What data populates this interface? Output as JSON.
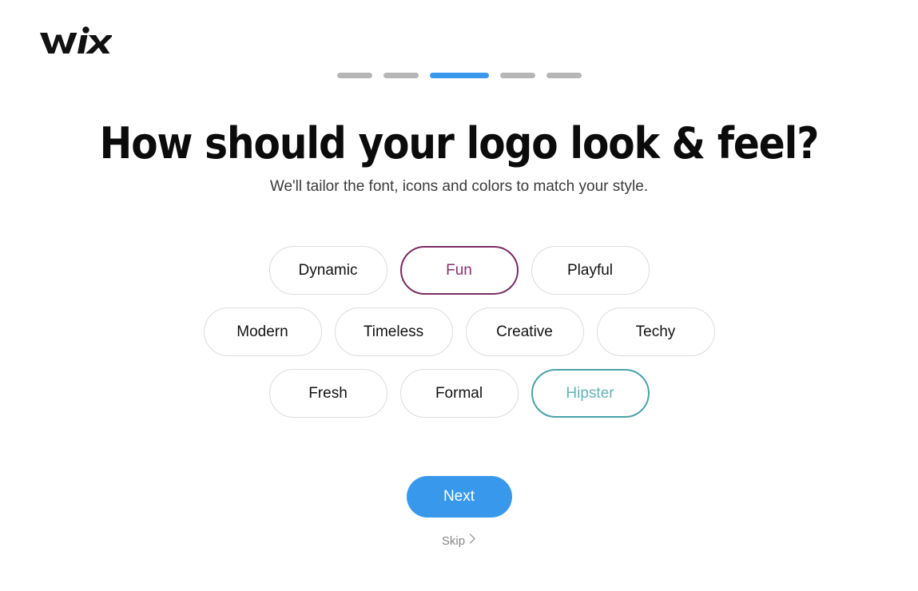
{
  "brand": {
    "name": "Wix",
    "logo_icon": "wix-logo"
  },
  "progress": {
    "total_steps": 5,
    "current_step": 3,
    "steps": [
      {
        "state": "inactive"
      },
      {
        "state": "inactive"
      },
      {
        "state": "active"
      },
      {
        "state": "inactive"
      },
      {
        "state": "inactive"
      }
    ],
    "active_color": "#3899ec",
    "inactive_color": "#b6b6b6"
  },
  "main": {
    "heading": "How should your logo look & feel?",
    "subheading": "We'll tailor the font, icons and colors to match your style."
  },
  "style_options": {
    "rows": [
      [
        {
          "label": "Dynamic",
          "selected": false
        },
        {
          "label": "Fun",
          "selected": true,
          "accent": "#7a2d62"
        },
        {
          "label": "Playful",
          "selected": false
        }
      ],
      [
        {
          "label": "Modern",
          "selected": false
        },
        {
          "label": "Timeless",
          "selected": false
        },
        {
          "label": "Creative",
          "selected": false
        },
        {
          "label": "Techy",
          "selected": false
        }
      ],
      [
        {
          "label": "Fresh",
          "selected": false
        },
        {
          "label": "Formal",
          "selected": false
        },
        {
          "label": "Hipster",
          "selected": true,
          "accent": "#49a2a7"
        }
      ]
    ]
  },
  "actions": {
    "next_label": "Next",
    "next_color": "#3899ec",
    "skip_label": "Skip",
    "skip_icon": "chevron-right-icon"
  }
}
